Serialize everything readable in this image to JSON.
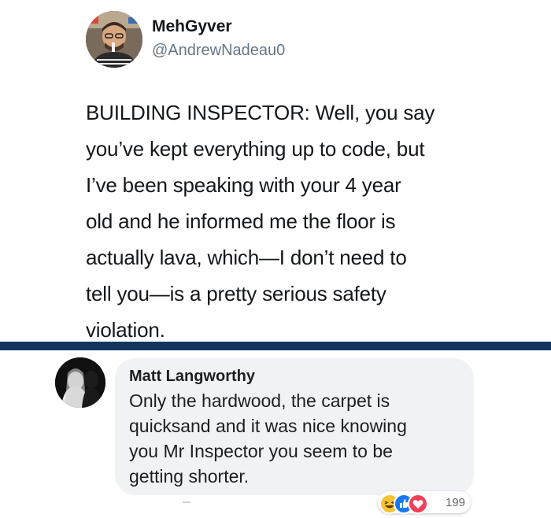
{
  "tweet": {
    "display_name": "MehGyver",
    "handle": "@AndrewNadeau0",
    "text_lines": [
      "BUILDING INSPECTOR: Well, you say",
      "you’ve kept everything up to code, but",
      "I’ve been speaking with your 4 year",
      "old and he informed me the floor is",
      "actually lava, which—I don’t need to",
      "tell you—is a pretty serious safety",
      "violation."
    ]
  },
  "comment": {
    "author": "Matt Langworthy",
    "text_lines": [
      "Only the hardwood, the carpet is",
      "quicksand and it was nice knowing",
      "you Mr Inspector you seem to be",
      "getting shorter."
    ],
    "reactions": {
      "icons": [
        "haha-icon",
        "like-icon",
        "love-icon"
      ],
      "count": "199"
    }
  },
  "colors": {
    "divider": "#11375f",
    "tweet_handle": "#657786",
    "comment_bubble": "#f0f2f5",
    "like": "#1877f2",
    "love": "#f33e58",
    "haha": "#f7c331"
  }
}
